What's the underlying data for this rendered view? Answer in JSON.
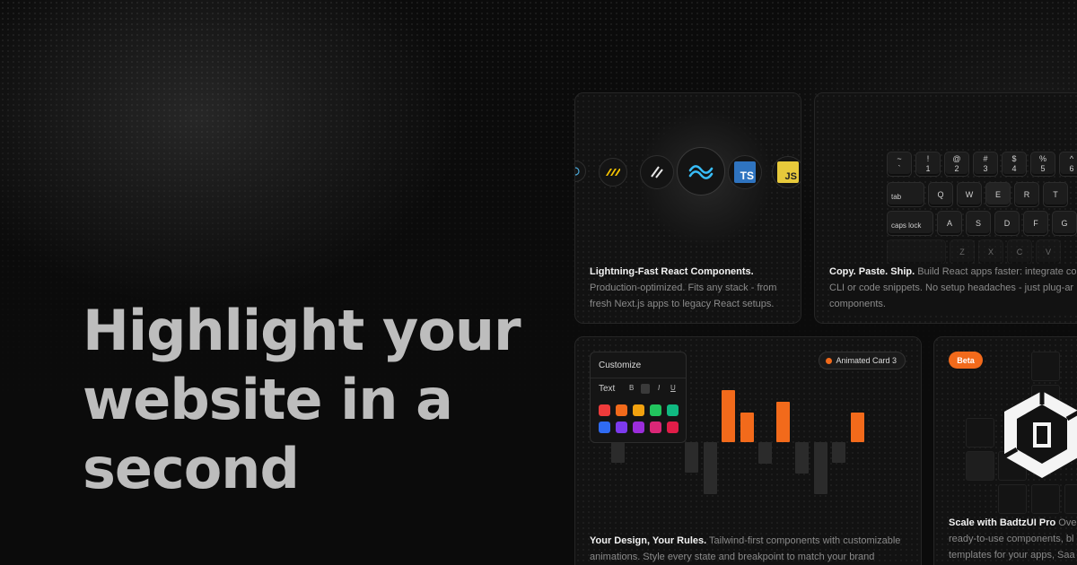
{
  "headline": {
    "line1": "Highlight your",
    "line2": "website in a",
    "line3": "second"
  },
  "cards": {
    "components": {
      "title": "Lightning-Fast React Components.",
      "description_line1": "Production-optimized. Fits any stack - from",
      "description_line2": "fresh Next.js apps to legacy React setups.",
      "icons": [
        "react-icon",
        "motion-icon",
        "nextjs-icon",
        "tailwind-icon",
        "typescript-icon",
        "javascript-icon"
      ],
      "ts_label": "TS",
      "js_label": "JS"
    },
    "copy_paste": {
      "title": "Copy. Paste. Ship.",
      "description_line1_rest": " Build React apps faster: integrate cor",
      "description_line2": "CLI or code snippets. No setup headaches - just plug-ar",
      "description_line3": "components.",
      "keys_row0": [
        {
          "top": "~",
          "bottom": "`"
        },
        {
          "top": "!",
          "bottom": "1"
        },
        {
          "top": "@",
          "bottom": "2"
        },
        {
          "top": "#",
          "bottom": "3"
        },
        {
          "top": "$",
          "bottom": "4"
        },
        {
          "top": "%",
          "bottom": "5"
        },
        {
          "top": "^",
          "bottom": "6"
        }
      ],
      "keys_row1": [
        "tab",
        "Q",
        "W",
        "E",
        "R",
        "T"
      ],
      "keys_row2": [
        "caps lock",
        "A",
        "S",
        "D",
        "F",
        "G"
      ],
      "keys_row3": [
        "Z",
        "X",
        "C",
        "V"
      ]
    },
    "design": {
      "title": "Your Design, Your Rules.",
      "description_line1_rest": " Tailwind-first components with customizable",
      "description_line2": "animations. Style every state and breakpoint to match your brand",
      "panel_title": "Customize",
      "panel_text_label": "Text",
      "format_buttons": [
        "B",
        "☐",
        "I",
        "U"
      ],
      "swatch_colors": [
        "#ef3b3b",
        "#f26a1b",
        "#f2a20f",
        "#22c55e",
        "#10b981",
        "#2f6bf2",
        "#7c3aed",
        "#9b2ddb",
        "#db2777",
        "#e11d48"
      ],
      "badge_label": "Animated Card 3",
      "accent_color": "#f26a1b"
    },
    "pro": {
      "badge": "Beta",
      "title": "Scale with BadtzUI Pro",
      "title_rest": " Ove",
      "description_line2": "ready-to-use components, bl",
      "description_line3": "templates for your apps, Saa"
    }
  }
}
